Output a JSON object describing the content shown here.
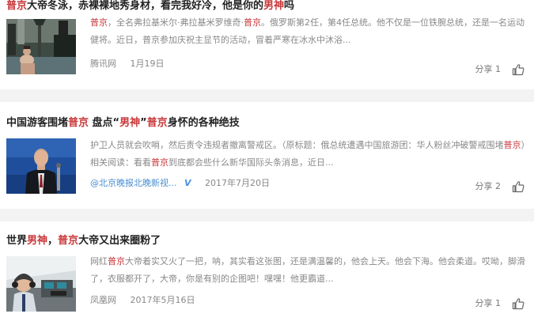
{
  "articles": [
    {
      "title_parts": [
        {
          "text": "普京",
          "hl": true
        },
        {
          "text": "大帝冬泳，赤裸裸地秀身材，看完我好冷，他是你的",
          "hl": false
        },
        {
          "text": "男神",
          "hl": true
        },
        {
          "text": "吗",
          "hl": false
        }
      ],
      "snippet_parts": [
        {
          "text": "普京",
          "hl": true
        },
        {
          "text": "，全名弗拉基米尔·弗拉基米罗维奇·",
          "hl": false
        },
        {
          "text": "普京",
          "hl": true
        },
        {
          "text": "。俄罗斯第2任，第4任总统。他不仅是一位铁腕总统，还是一名运动健将。近日，普京参加庆祝主显节的活动，冒着严寒在冰水中沐浴...",
          "hl": false
        }
      ],
      "source": "腾讯网",
      "date": "1月19日",
      "share_label": "分享",
      "share_count": "1",
      "thumb_icon": "ice-swim-photo"
    },
    {
      "title_parts": [
        {
          "text": "中国游客围堵",
          "hl": false
        },
        {
          "text": "普京",
          "hl": true
        },
        {
          "text": " 盘点“",
          "hl": false
        },
        {
          "text": "男神",
          "hl": true
        },
        {
          "text": "”",
          "hl": false
        },
        {
          "text": "普京",
          "hl": true
        },
        {
          "text": "身怀的各种绝技",
          "hl": false
        }
      ],
      "snippet_parts": [
        {
          "text": "护卫人员就会吹哨，然后责令违规者撤离警戒区。（原标题：俄总统遭遇中国旅游团：华人粉丝冲破警戒围堵",
          "hl": false
        },
        {
          "text": "普京",
          "hl": true
        },
        {
          "text": "）相关阅读：看看",
          "hl": false
        },
        {
          "text": "普京",
          "hl": true
        },
        {
          "text": "到底都会些什么新华国际头条消息，近日...",
          "hl": false
        }
      ],
      "source": "@北京晚报北晚新视...",
      "verified_badge": "V",
      "date": "2017年7月20日",
      "share_label": "分享",
      "share_count": "2",
      "thumb_icon": "podium-speech-photo"
    },
    {
      "title_parts": [
        {
          "text": "世界",
          "hl": false
        },
        {
          "text": "男神",
          "hl": true
        },
        {
          "text": "，",
          "hl": false
        },
        {
          "text": "普京",
          "hl": true
        },
        {
          "text": "大帝又出来圈粉了",
          "hl": false
        }
      ],
      "snippet_parts": [
        {
          "text": "网红",
          "hl": false
        },
        {
          "text": "普京",
          "hl": true
        },
        {
          "text": "大帝着实又火了一把，呐，其实看这张图，还是满温馨的，他会上天。他会下海。他会柔道。哎呦，脚滑了，衣服都开了，大帝，你是有别的企图吧！嘿嘿！他更霸道...",
          "hl": false
        }
      ],
      "source": "凤凰网",
      "date": "2017年5月16日",
      "share_label": "分享",
      "share_count": "1",
      "thumb_icon": "cockpit-photo"
    }
  ],
  "colors": {
    "highlight": "#c9383a",
    "meta": "#888888",
    "separator": "#f3f3f3",
    "link": "#4a8fd1"
  }
}
